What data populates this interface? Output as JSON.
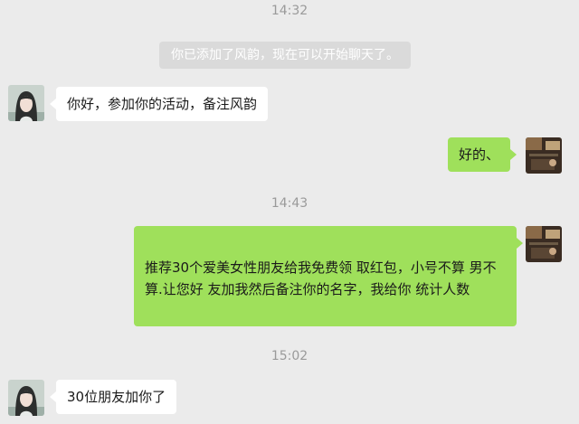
{
  "chat": {
    "time_1": "14:32",
    "system_notice": "你已添加了风韵，现在可以开始聊天了。",
    "msg_1": "你好，参加你的活动，备注风韵",
    "msg_2": "好的、",
    "time_2": "14:43",
    "msg_3": "推荐30个爱美女性朋友给我免费领 取红包，小号不算 男不算.让您好 友加我然后备注你的名字，我给你 统计人数",
    "time_3": "15:02",
    "msg_4": "30位朋友加你了"
  },
  "colors": {
    "background": "#ebebeb",
    "sent_bubble": "#9fe05b",
    "received_bubble": "#ffffff",
    "system_notice_bg": "#dadada",
    "timestamp_text": "#9a9a9a"
  },
  "icons": {
    "contact_avatar": "avatar-contact-icon",
    "own_avatar": "avatar-self-icon"
  }
}
